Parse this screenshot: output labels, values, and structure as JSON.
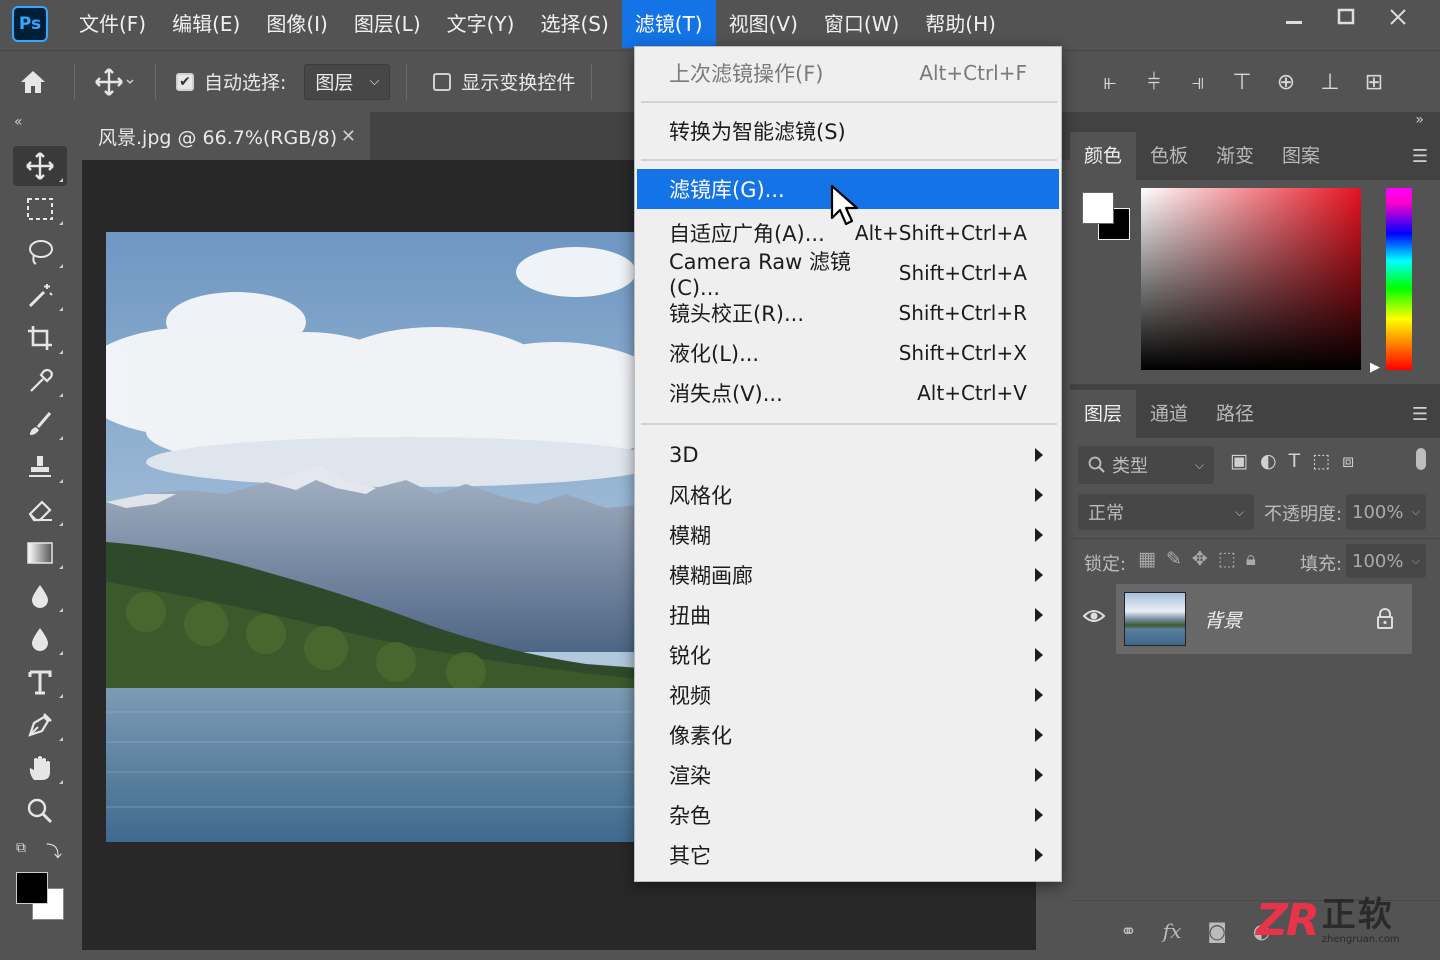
{
  "app": {
    "logo_text": "Ps"
  },
  "menubar": {
    "items": [
      "文件(F)",
      "编辑(E)",
      "图像(I)",
      "图层(L)",
      "文字(Y)",
      "选择(S)",
      "滤镜(T)",
      "视图(V)",
      "窗口(W)",
      "帮助(H)"
    ],
    "active_index": 6
  },
  "options_bar": {
    "auto_select_label": "自动选择:",
    "auto_select_checked": true,
    "auto_select_target": "图层",
    "show_transform_label": "显示变换控件",
    "show_transform_checked": false
  },
  "document": {
    "tab_title": "风景.jpg @ 66.7%(RGB/8)"
  },
  "filter_menu": {
    "items": [
      {
        "label": "上次滤镜操作(F)",
        "shortcut": "Alt+Ctrl+F",
        "disabled": true
      },
      {
        "label": "转换为智能滤镜(S)",
        "shortcut": ""
      },
      {
        "label": "滤镜库(G)...",
        "shortcut": "",
        "highlighted": true
      },
      {
        "label": "自适应广角(A)...",
        "shortcut": "Alt+Shift+Ctrl+A"
      },
      {
        "label": "Camera Raw 滤镜(C)...",
        "shortcut": "Shift+Ctrl+A"
      },
      {
        "label": "镜头校正(R)...",
        "shortcut": "Shift+Ctrl+R"
      },
      {
        "label": "液化(L)...",
        "shortcut": "Shift+Ctrl+X"
      },
      {
        "label": "消失点(V)...",
        "shortcut": "Alt+Ctrl+V"
      }
    ],
    "submenus": [
      "3D",
      "风格化",
      "模糊",
      "模糊画廊",
      "扭曲",
      "锐化",
      "视频",
      "像素化",
      "渲染",
      "杂色",
      "其它"
    ]
  },
  "color_panel": {
    "tabs": [
      "颜色",
      "色板",
      "渐变",
      "图案"
    ],
    "active_tab": 0
  },
  "layers_panel": {
    "tabs": [
      "图层",
      "通道",
      "路径"
    ],
    "active_tab": 0,
    "filter_label": "类型",
    "blend_mode": "正常",
    "opacity_label": "不透明度:",
    "opacity_value": "100%",
    "lock_label": "锁定:",
    "fill_label": "填充:",
    "fill_value": "100%",
    "layers": [
      {
        "name": "背景",
        "visible": true,
        "locked": true
      }
    ]
  },
  "watermark": {
    "brand": "ZR",
    "text": "正软",
    "url_text": "zhengruan.com"
  }
}
